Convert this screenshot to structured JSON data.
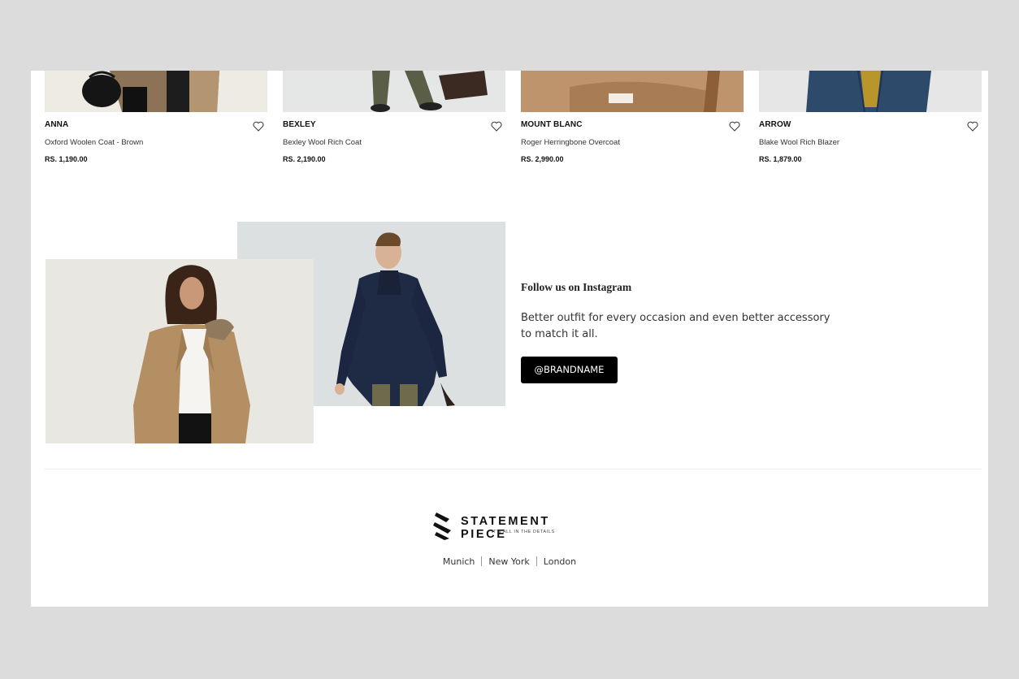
{
  "products": [
    {
      "brand": "ANNA",
      "name": "Oxford Woolen Coat - Brown",
      "price": "RS. 1,190.00"
    },
    {
      "brand": "BEXLEY",
      "name": "Bexley Wool Rich Coat",
      "price": "RS. 2,190.00"
    },
    {
      "brand": "MOUNT BLANC",
      "name": "Roger Herringbone Overcoat",
      "price": "RS. 2,990.00"
    },
    {
      "brand": "ARROW",
      "name": "Blake Wool Rich Blazer",
      "price": "RS. 1,879.00"
    }
  ],
  "instagram": {
    "title": "Follow us on Instagram",
    "text": "Better outfit for every occasion and even better accessory to match it all.",
    "button": "@BRANDNAME"
  },
  "footer": {
    "logo_name": "STATEMENT PIECE",
    "logo_tagline": "IT'S ALL IN THE DETAILS",
    "cities": [
      "Munich",
      "New York",
      "London"
    ]
  },
  "colors": {
    "background": "#dcdcdc",
    "page": "#ffffff",
    "button": "#000000"
  },
  "icons": {
    "wishlist": "heart-icon"
  }
}
